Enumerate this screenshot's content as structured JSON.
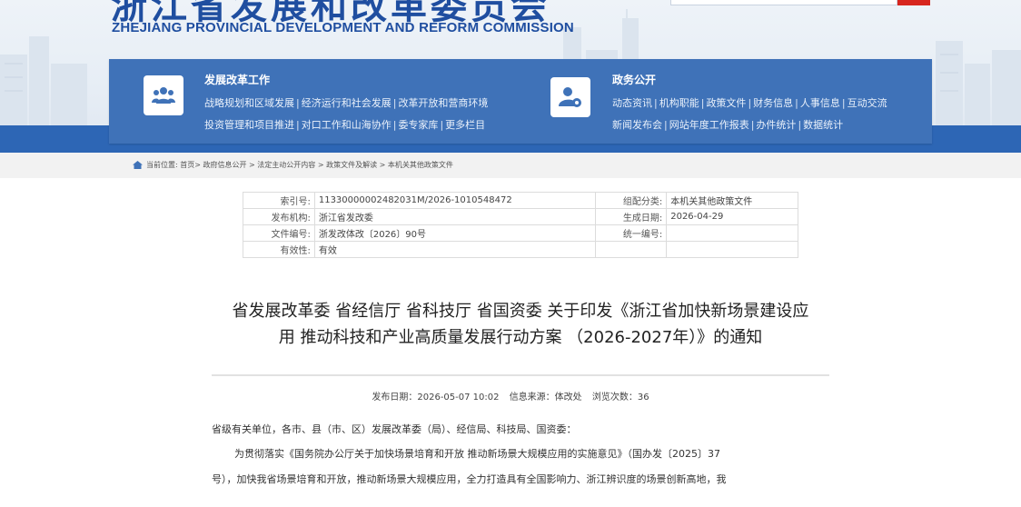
{
  "header": {
    "site_name_cn": "浙江省发展和改革委员会",
    "site_name_en": "ZHEJIANG PROVINCIAL DEVELOPMENT AND REFORM COMMISSION"
  },
  "nav": {
    "left": {
      "icon": "people-group-icon",
      "title": "发展改革工作",
      "row1": [
        "战略规划和区域发展",
        "经济运行和社会发展",
        "改革开放和营商环境"
      ],
      "row2": [
        "投资管理和项目推进",
        "对口工作和山海协作",
        "委专家库",
        "更多栏目"
      ]
    },
    "right": {
      "icon": "user-settings-icon",
      "title": "政务公开",
      "row1": [
        "动态资讯",
        "机构职能",
        "政策文件",
        "财务信息",
        "人事信息",
        "互动交流"
      ],
      "row2": [
        "新闻发布会",
        "网站年度工作报表",
        "办件统计",
        "数据统计"
      ]
    }
  },
  "breadcrumb": {
    "prefix": "当前位置:",
    "items": [
      "首页",
      "政府信息公开",
      "法定主动公开内容",
      "政策文件及解读",
      "本机关其他政策文件"
    ]
  },
  "meta": [
    {
      "k1": "索引号:",
      "v1": "11330000002482031M/2026-1010548472",
      "k2": "组配分类:",
      "v2": "本机关其他政策文件"
    },
    {
      "k1": "发布机构:",
      "v1": "浙江省发改委",
      "k2": "生成日期:",
      "v2": "2026-04-29"
    },
    {
      "k1": "文件编号:",
      "v1": "浙发改体改〔2026〕90号",
      "k2": "统一编号:",
      "v2": ""
    },
    {
      "k1": "有效性:",
      "v1": "有效",
      "k2": "",
      "v2": ""
    }
  ],
  "doc": {
    "title_line1": "省发展改革委 省经信厅 省科技厅 省国资委 关于印发《浙江省加快新场景建设应",
    "title_line2": "用 推动科技和产业高质量发展行动方案 （2026-2027年）》的通知",
    "publish_date": "发布日期：2026-05-07 10:02",
    "source": "信息来源：体改处",
    "views": "浏览次数：36",
    "para0": "省级有关单位，各市、县（市、区）发展改革委（局）、经信局、科技局、国资委：",
    "para1": "为贯彻落实《国务院办公厅关于加快场景培育和开放 推动新场景大规模应用的实施意见》（国办发〔2025〕37",
    "para2": "号），加快我省场景培育和开放，推动新场景大规模应用，全力打造具有全国影响力、浙江辨识度的场景创新高地，我"
  },
  "colors": {
    "brand_blue": "#1f4ea0",
    "nav_panel": "#3f72b8",
    "band_blue": "#2d66b5",
    "search_button_red": "#d7261e"
  }
}
